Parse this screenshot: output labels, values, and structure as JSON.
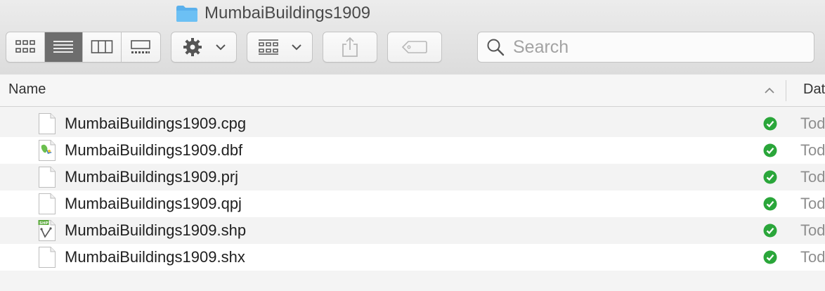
{
  "window": {
    "title": "MumbaiBuildings1909",
    "title_icon": "folder-icon"
  },
  "toolbar": {
    "view_modes": [
      {
        "name": "icon-view",
        "icon": "grid-icon",
        "active": false
      },
      {
        "name": "list-view",
        "icon": "list-icon",
        "active": true
      },
      {
        "name": "column-view",
        "icon": "columns-icon",
        "active": false
      },
      {
        "name": "gallery-view",
        "icon": "gallery-icon",
        "active": false
      }
    ],
    "action_icon": "gear-icon",
    "group_icon": "group-icon",
    "share_icon": "share-icon",
    "tags_icon": "tag-icon",
    "accent_active": "#6d6d6d"
  },
  "search": {
    "placeholder": "Search",
    "value": ""
  },
  "columns": {
    "name": "Name",
    "date": "Dat",
    "sort_indicator": "chevron-up-icon"
  },
  "files": [
    {
      "name": "MumbaiBuildings1909.cpg",
      "icon": "document-icon",
      "status": "synced",
      "date": "Tod"
    },
    {
      "name": "MumbaiBuildings1909.dbf",
      "icon": "dbf-file-icon",
      "status": "synced",
      "date": "Tod"
    },
    {
      "name": "MumbaiBuildings1909.prj",
      "icon": "document-icon",
      "status": "synced",
      "date": "Tod"
    },
    {
      "name": "MumbaiBuildings1909.qpj",
      "icon": "document-icon",
      "status": "synced",
      "date": "Tod"
    },
    {
      "name": "MumbaiBuildings1909.shp",
      "icon": "shp-file-icon",
      "status": "synced",
      "date": "Tod"
    },
    {
      "name": "MumbaiBuildings1909.shx",
      "icon": "document-icon",
      "status": "synced",
      "date": "Tod"
    }
  ],
  "colors": {
    "sync_green": "#2aa63a",
    "folder_blue": "#5ab0ec"
  }
}
